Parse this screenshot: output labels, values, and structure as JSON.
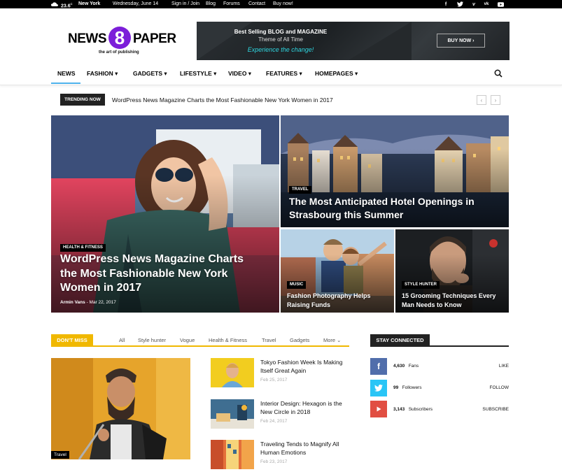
{
  "topbar": {
    "temp": "23.6",
    "temp_unit": "C",
    "city": "New York",
    "date": "Wednesday, June 14",
    "links": [
      "Sign in / Join",
      "Blog",
      "Forums",
      "Contact",
      "Buy now!"
    ],
    "social_icons": [
      "facebook-icon",
      "twitter-icon",
      "vimeo-icon",
      "vk-icon",
      "youtube-icon"
    ]
  },
  "logo": {
    "word_left": "NEWS",
    "digit": "8",
    "word_right": "PAPER",
    "tagline": "the art of publishing",
    "accent": "#7c1ed9"
  },
  "banner": {
    "line1": "Best Selling BLOG and MAGAZINE",
    "line2": "Theme of All Time",
    "line3": "Experience the change!",
    "cta": "BUY NOW ›"
  },
  "nav": {
    "items": [
      {
        "label": "NEWS"
      },
      {
        "label": "FASHION ▾"
      },
      {
        "label": "GADGETS ▾"
      },
      {
        "label": "LIFESTYLE ▾"
      },
      {
        "label": "VIDEO ▾"
      },
      {
        "label": "FEATURES ▾"
      },
      {
        "label": "HOMEPAGES ▾"
      }
    ],
    "active_color": "#4db2ec"
  },
  "trending": {
    "label": "TRENDING NOW",
    "text": "WordPress News Magazine Charts the Most Fashionable New York Women in 2017",
    "prev": "‹",
    "next": "›"
  },
  "hero": {
    "main": {
      "category": "HEALTH & FITNESS",
      "title": "WordPress News Magazine Charts the Most Fashionable New York Women in 2017",
      "author": "Armin Vans",
      "date": "Mar 22, 2017"
    },
    "top_right": {
      "category": "TRAVEL",
      "title": "The Most Anticipated Hotel Openings in Strasbourg this Summer"
    },
    "bottom_left": {
      "category": "MUSIC",
      "title": "Fashion Photography Helps Raising Funds"
    },
    "bottom_right": {
      "category": "STYLE HUNTER",
      "title": "15 Grooming Techniques Every Man Needs to Know"
    }
  },
  "dont_miss": {
    "label": "DON'T MISS",
    "filters": [
      "All",
      "Style hunter",
      "Vogue",
      "Health & Fitness",
      "Travel",
      "Gadgets",
      "More ⌄"
    ],
    "main_category": "Travel",
    "accent": "#f0b800",
    "side_posts": [
      {
        "title": "Tokyo Fashion Week Is Making Itself Great Again",
        "date": "Feb 25, 2017"
      },
      {
        "title": "Interior Design: Hexagon is the New Circle in 2018",
        "date": "Feb 24, 2017"
      },
      {
        "title": "Traveling Tends to Magnify All Human Emotions",
        "date": "Feb 23, 2017"
      }
    ]
  },
  "stay_connected": {
    "label": "STAY CONNECTED",
    "rows": [
      {
        "icon": "facebook-icon",
        "count": "4,630",
        "unit": "Fans",
        "action": "LIKE",
        "color": "#516eab"
      },
      {
        "icon": "twitter-icon",
        "count": "99",
        "unit": "Followers",
        "action": "FOLLOW",
        "color": "#29c5f6"
      },
      {
        "icon": "youtube-icon",
        "count": "3,143",
        "unit": "Subscribers",
        "action": "SUBSCRIBE",
        "color": "#e14e42"
      }
    ]
  }
}
